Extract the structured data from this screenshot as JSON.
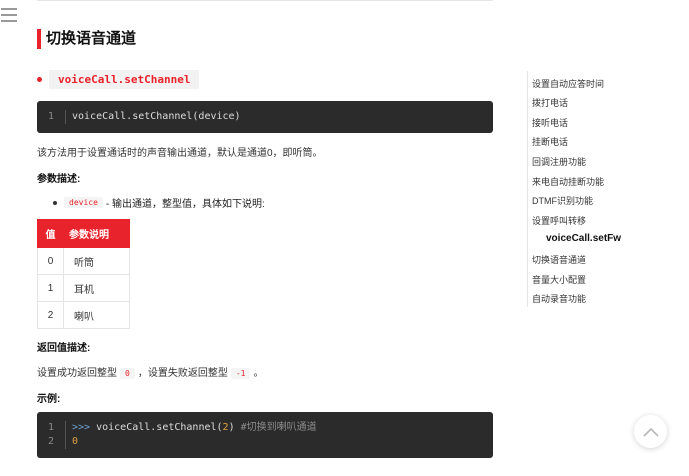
{
  "heading": "切换语音通道",
  "function_name": "voiceCall.setChannel",
  "code_block_1": {
    "lines": [
      {
        "no": "1",
        "code": "voiceCall.setChannel(device)"
      }
    ]
  },
  "description": "该方法用于设置通话时的声音输出通道，默认是通道0，即听筒。",
  "params_heading": "参数描述:",
  "param": {
    "name": "device",
    "desc": "- 输出通道，整型值，具体如下说明:"
  },
  "table": {
    "headers": [
      "值",
      "参数说明"
    ],
    "rows": [
      {
        "value": "0",
        "desc": "听筒"
      },
      {
        "value": "1",
        "desc": "耳机"
      },
      {
        "value": "2",
        "desc": "喇叭"
      }
    ]
  },
  "return_heading": "返回值描述:",
  "return_desc": {
    "part1": "设置成功返回整型",
    "ok": "0",
    "part2": "，设置失败返回整型",
    "fail": "-1",
    "part3": "。"
  },
  "example_heading": "示例:",
  "code_block_2": {
    "line1": {
      "no": "1",
      "prompt": ">>>",
      "call": "voiceCall.setChannel(",
      "arg": "2",
      "close": ")",
      "comment": "#切换到喇叭通道"
    },
    "line2": {
      "no": "2",
      "output": "0"
    }
  },
  "toc": [
    "设置自动应答时间",
    "拨打电话",
    "接听电话",
    "挂断电话",
    "回调注册功能",
    "来电自动挂断功能",
    "DTMF识别功能",
    "设置呼叫转移",
    "voiceCall.setFw",
    "切换语音通道",
    "音量大小配置",
    "自动录音功能"
  ],
  "icons": {
    "menu": "hamburger-menu-icon",
    "back_to_top": "chevron-up-icon"
  },
  "colors": {
    "accent": "#e8232b",
    "code_bg": "#2b2b2b"
  }
}
